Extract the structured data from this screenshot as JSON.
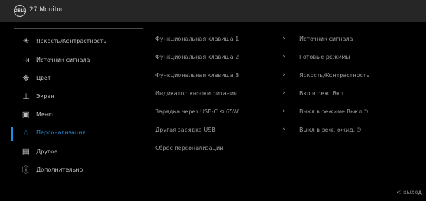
{
  "header": {
    "logo_text": "DELL",
    "model": "27 Monitor"
  },
  "menu": {
    "items": [
      {
        "icon": "brightness-icon",
        "glyph": "☀",
        "label": "Яркость/Контрастность"
      },
      {
        "icon": "input-source-icon",
        "glyph": "⇥",
        "label": "Источник сигнала"
      },
      {
        "icon": "color-icon",
        "glyph": "❋",
        "label": "Цвет"
      },
      {
        "icon": "display-icon",
        "glyph": "⊥",
        "label": "Экран"
      },
      {
        "icon": "menu-icon",
        "glyph": "▣",
        "label": "Меню"
      },
      {
        "icon": "star-icon",
        "glyph": "☆",
        "label": "Персонализация"
      },
      {
        "icon": "others-icon",
        "glyph": "▤",
        "label": "Другое"
      },
      {
        "icon": "info-icon",
        "glyph": "ⓘ",
        "label": "Дополнительно"
      }
    ],
    "active_index": 5
  },
  "submenu": {
    "column1": [
      "Функциональная клавиша 1",
      "Функциональная клавиша 2",
      "Функциональная клавиша 3",
      "Индикатор кнопки питания",
      "Зарядка через USB-C ⟲ 65W",
      "Другая зарядка USB",
      "Сброс персонализации"
    ],
    "column2": [
      "Источник сигнала",
      "Готовые режимы",
      "Яркость/Контрастность",
      "Вкл в реж. Вкл",
      "Выкл в режиме Выкл ⏻",
      "Выкл в реж. ожид. ⏻"
    ],
    "arrow": "›"
  },
  "footer": {
    "back_label": "< Выход"
  },
  "colors": {
    "accent": "#1b8fe0",
    "background": "#000000",
    "header": "#262626"
  }
}
